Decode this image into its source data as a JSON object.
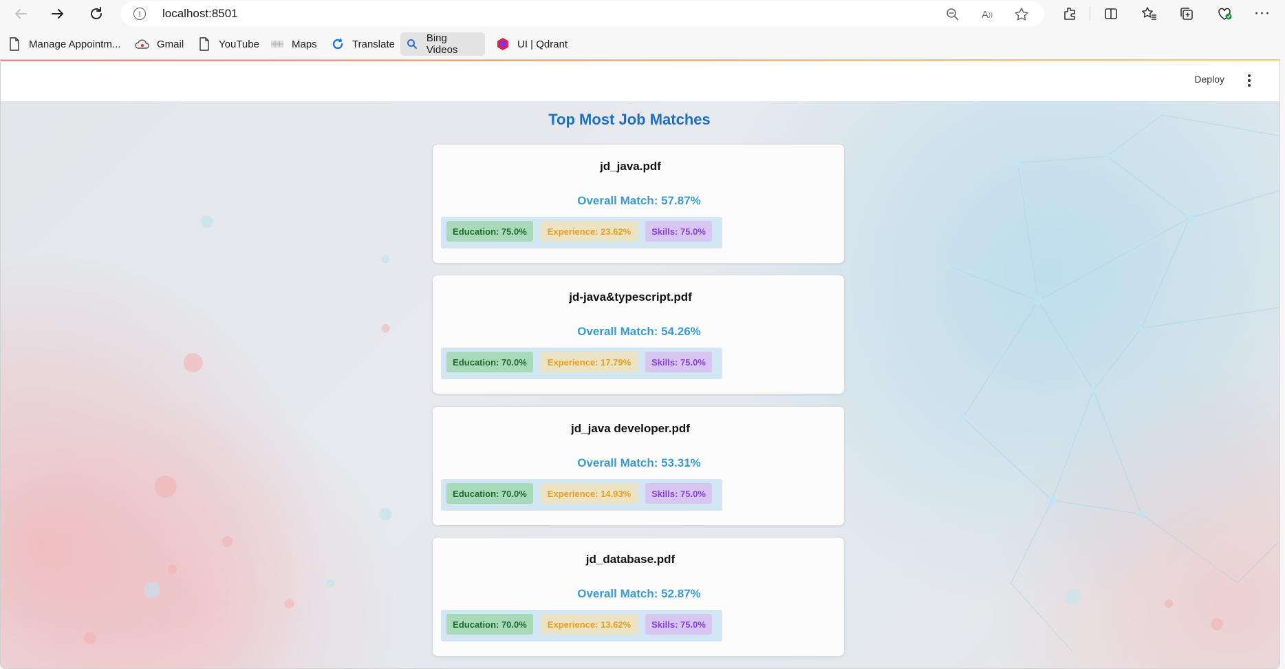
{
  "browser": {
    "url": "localhost:8501",
    "bookmarks": [
      {
        "label": "Manage Appointm...",
        "icon": "page-icon"
      },
      {
        "label": "Gmail",
        "icon": "cloud-icon"
      },
      {
        "label": "YouTube",
        "icon": "page-icon"
      },
      {
        "label": "Maps",
        "icon": "map-icon"
      },
      {
        "label": "Translate",
        "icon": "translate-icon"
      },
      {
        "label": "Bing Videos",
        "icon": "search-icon"
      },
      {
        "label": "UI | Qdrant",
        "icon": "qdrant-icon"
      }
    ]
  },
  "app": {
    "deploy_label": "Deploy",
    "title": "Top Most Job Matches",
    "matches": [
      {
        "file": "jd_java.pdf",
        "overall": "Overall Match: 57.87%",
        "education": "Education: 75.0%",
        "experience": "Experience: 23.62%",
        "skills": "Skills: 75.0%"
      },
      {
        "file": "jd-java&typescript.pdf",
        "overall": "Overall Match: 54.26%",
        "education": "Education: 70.0%",
        "experience": "Experience: 17.79%",
        "skills": "Skills: 75.0%"
      },
      {
        "file": "jd_java developer.pdf",
        "overall": "Overall Match: 53.31%",
        "education": "Education: 70.0%",
        "experience": "Experience: 14.93%",
        "skills": "Skills: 75.0%"
      },
      {
        "file": "jd_database.pdf",
        "overall": "Overall Match: 52.87%",
        "education": "Education: 70.0%",
        "experience": "Experience: 13.62%",
        "skills": "Skills: 75.0%"
      }
    ]
  },
  "colors": {
    "title": "#1f6fbf",
    "overall": "#3a9bd0",
    "education_bg": "#a8d9b8",
    "experience_bg": "#ece2c4",
    "skills_bg": "#d7c6ef"
  }
}
